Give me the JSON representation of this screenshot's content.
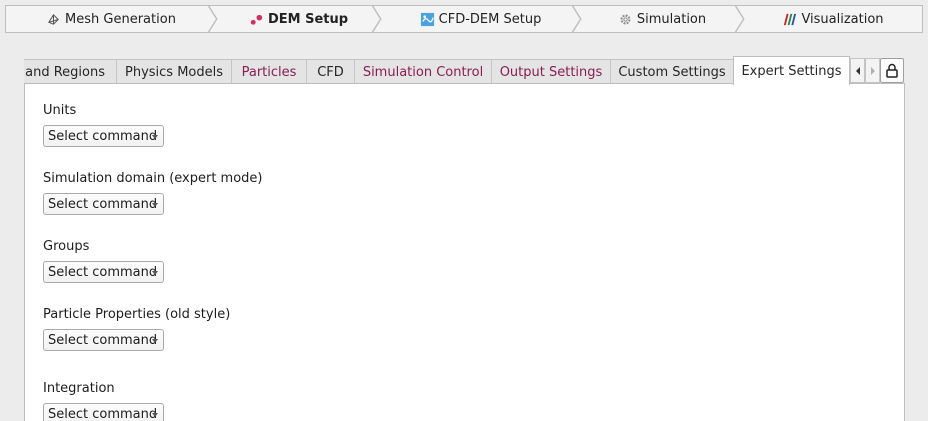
{
  "workflow": {
    "steps": [
      {
        "label": "Mesh Generation",
        "icon": "mesh-icon"
      },
      {
        "label": "DEM Setup",
        "icon": "particles-icon",
        "active": true
      },
      {
        "label": "CFD-DEM Setup",
        "icon": "cfd-dem-icon"
      },
      {
        "label": "Simulation",
        "icon": "gear-icon"
      },
      {
        "label": "Visualization",
        "icon": "paraview-icon"
      }
    ]
  },
  "tabs": [
    {
      "label": "s and Regions"
    },
    {
      "label": "Physics Models"
    },
    {
      "label": "Particles"
    },
    {
      "label": "CFD"
    },
    {
      "label": "Simulation Control"
    },
    {
      "label": "Output Settings"
    },
    {
      "label": "Custom Settings"
    },
    {
      "label": "Expert Settings",
      "active": true
    }
  ],
  "sections": [
    {
      "label": "Units",
      "select": "Select command"
    },
    {
      "label": "Simulation domain (expert mode)",
      "select": "Select command"
    },
    {
      "label": "Groups",
      "select": "Select command"
    },
    {
      "label": "Particle Properties (old style)",
      "select": "Select command"
    },
    {
      "label": "Integration",
      "select": "Select command"
    }
  ],
  "colors": {
    "pink_tab_text": "#8a1d54",
    "dem_icon": "#d0305a",
    "cfd_dem_icon": "#4aa3df"
  }
}
